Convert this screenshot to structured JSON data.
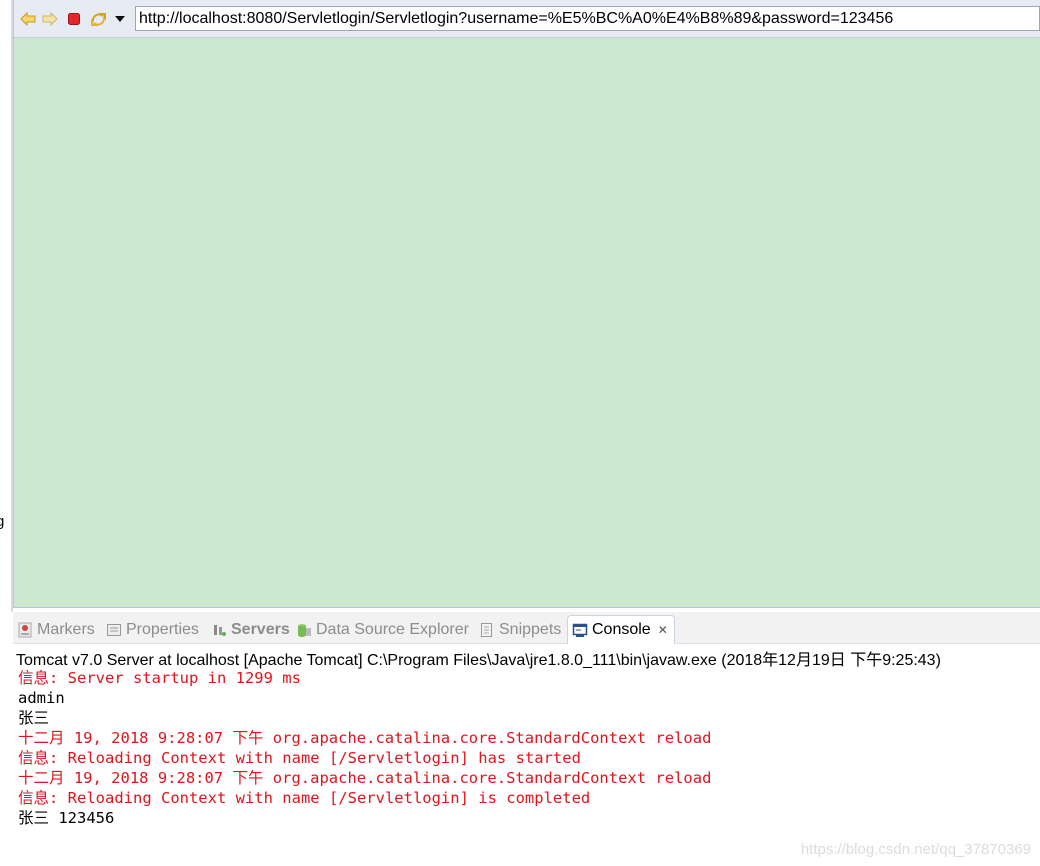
{
  "browser": {
    "url": "http://localhost:8080/Servletlogin/Servletlogin?username=%E5%BC%A0%E4%B8%89&password=123456",
    "buttons": [
      "back-icon",
      "forward-icon",
      "stop-icon",
      "refresh-icon",
      "dropdown-icon"
    ],
    "page_background": "#cce7cf"
  },
  "left_edge_char": "g",
  "views": {
    "tabs": [
      {
        "label": "Markers",
        "icon": "markers-icon"
      },
      {
        "label": "Properties",
        "icon": "properties-icon"
      },
      {
        "label": "Servers",
        "icon": "servers-icon"
      },
      {
        "label": "Data Source Explorer",
        "icon": "data-source-icon"
      },
      {
        "label": "Snippets",
        "icon": "snippets-icon"
      },
      {
        "label": "Console",
        "icon": "console-icon",
        "active": true,
        "close": "✕"
      }
    ]
  },
  "console": {
    "title": "Tomcat v7.0 Server at localhost [Apache Tomcat] C:\\Program Files\\Java\\jre1.8.0_111\\bin\\javaw.exe (2018年12月19日 下午9:25:43)",
    "lines": [
      {
        "text": "信息: Server startup in 1299 ms",
        "type": "err"
      },
      {
        "text": "admin",
        "type": "out"
      },
      {
        "text": "张三",
        "type": "out"
      },
      {
        "text": "十二月 19, 2018 9:28:07 下午 org.apache.catalina.core.StandardContext reload",
        "type": "err"
      },
      {
        "text": "信息: Reloading Context with name [/Servletlogin] has started",
        "type": "err"
      },
      {
        "text": "十二月 19, 2018 9:28:07 下午 org.apache.catalina.core.StandardContext reload",
        "type": "err"
      },
      {
        "text": "信息: Reloading Context with name [/Servletlogin] is completed",
        "type": "err"
      },
      {
        "text": "张三 123456",
        "type": "out"
      }
    ]
  },
  "watermark": "https://blog.csdn.net/qq_37870369",
  "colors": {
    "error_text": "#e0141e",
    "toolbar_bg": "#e7ecf4",
    "accent": "#4a78c2"
  }
}
